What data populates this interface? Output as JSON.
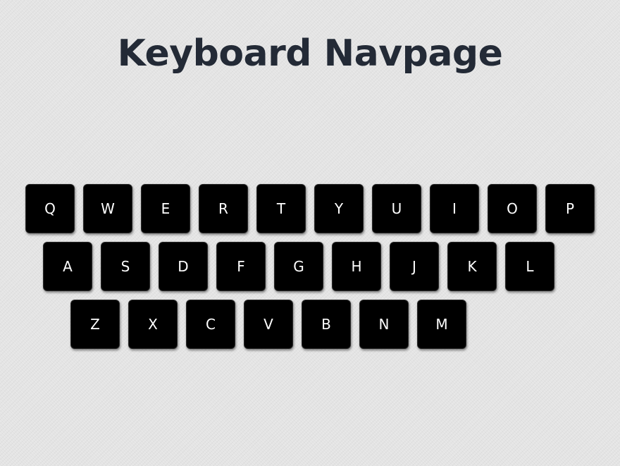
{
  "title": "Keyboard Navpage",
  "keyboard": {
    "rows": [
      {
        "keys": [
          "Q",
          "W",
          "E",
          "R",
          "T",
          "Y",
          "U",
          "I",
          "O",
          "P"
        ]
      },
      {
        "keys": [
          "A",
          "S",
          "D",
          "F",
          "G",
          "H",
          "J",
          "K",
          "L"
        ]
      },
      {
        "keys": [
          "Z",
          "X",
          "C",
          "V",
          "B",
          "N",
          "M"
        ]
      }
    ]
  },
  "colors": {
    "background": "#e4e4e4",
    "title": "#232a36",
    "key_background": "#000000",
    "key_text": "#ffffff"
  }
}
